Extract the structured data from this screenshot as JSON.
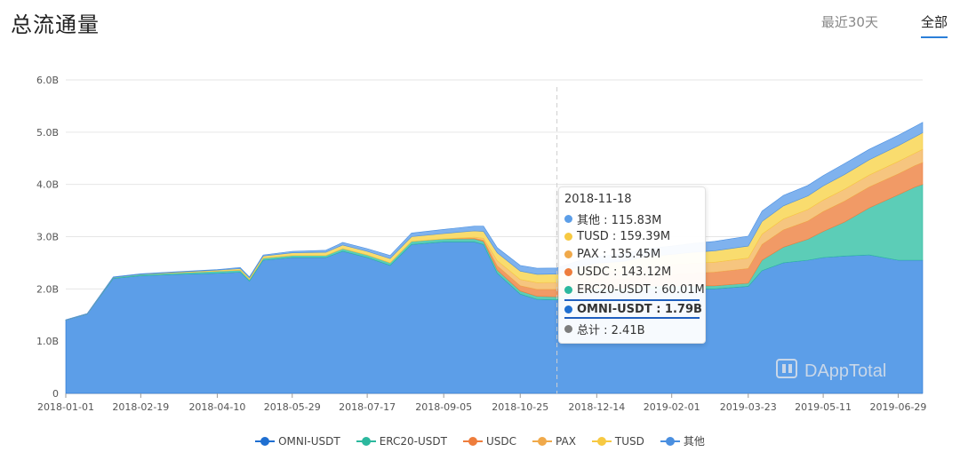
{
  "header": {
    "title": "总流通量",
    "tabs": [
      {
        "label": "最近30天",
        "active": false
      },
      {
        "label": "全部",
        "active": true
      }
    ]
  },
  "watermark": "DAppTotal",
  "tooltip": {
    "date": "2018-11-18",
    "rows": [
      {
        "text": "其他 : 115.83M",
        "color": "#5c9ee8",
        "highlight": false
      },
      {
        "text": "TUSD : 159.39M",
        "color": "#f7c942",
        "highlight": false
      },
      {
        "text": "PAX : 135.45M",
        "color": "#f0a94a",
        "highlight": false
      },
      {
        "text": "USDC : 143.12M",
        "color": "#ee7d3c",
        "highlight": false
      },
      {
        "text": "ERC20-USDT : 60.01M",
        "color": "#2cb89e",
        "highlight": false
      },
      {
        "text": "OMNI-USDT : 1.79B",
        "color": "#1f6fd1",
        "highlight": true
      },
      {
        "text": "总计 : 2.41B",
        "color": "#7d7d7d",
        "highlight": false
      }
    ]
  },
  "chart_data": {
    "type": "area",
    "stacked": true,
    "x": [
      "2018-01-01",
      "2018-01-15",
      "2018-02-01",
      "2018-02-19",
      "2018-03-15",
      "2018-04-10",
      "2018-04-25",
      "2018-05-01",
      "2018-05-10",
      "2018-05-29",
      "2018-06-20",
      "2018-07-01",
      "2018-07-17",
      "2018-08-01",
      "2018-08-15",
      "2018-09-05",
      "2018-09-25",
      "2018-10-01",
      "2018-10-10",
      "2018-10-25",
      "2018-11-05",
      "2018-11-18",
      "2018-12-01",
      "2018-12-14",
      "2019-01-01",
      "2019-01-15",
      "2019-02-01",
      "2019-02-15",
      "2019-03-01",
      "2019-03-23",
      "2019-04-01",
      "2019-04-15",
      "2019-05-01",
      "2019-05-11",
      "2019-05-25",
      "2019-06-10",
      "2019-06-29",
      "2019-07-10",
      "2019-07-15"
    ],
    "xticks": [
      "2018-01-01",
      "2018-02-19",
      "2018-04-10",
      "2018-05-29",
      "2018-07-17",
      "2018-09-05",
      "2018-10-25",
      "2018-12-14",
      "2019-02-01",
      "2019-03-23",
      "2019-05-11",
      "2019-06-29"
    ],
    "yticks": [
      "0",
      "1.0B",
      "2.0B",
      "3.0B",
      "4.0B",
      "5.0B",
      "6.0B"
    ],
    "ylim": [
      0,
      6.0
    ],
    "yunit": "B",
    "grid": true,
    "legend_position": "bottom",
    "crosshair_x": "2018-11-18",
    "series": [
      {
        "name": "OMNI-USDT",
        "color": "#1f6fd1",
        "fill": "#5c9ee8",
        "values": [
          1.4,
          1.52,
          2.2,
          2.25,
          2.28,
          2.3,
          2.32,
          2.15,
          2.55,
          2.6,
          2.6,
          2.72,
          2.6,
          2.45,
          2.85,
          2.9,
          2.9,
          2.85,
          2.3,
          1.9,
          1.8,
          1.79,
          1.9,
          1.95,
          1.95,
          2.0,
          2.0,
          2.0,
          2.0,
          2.05,
          2.35,
          2.5,
          2.55,
          2.6,
          2.63,
          2.65,
          2.55,
          2.55,
          2.55
        ]
      },
      {
        "name": "ERC20-USDT",
        "color": "#2cb89e",
        "fill": "#5ccdb7",
        "values": [
          0.005,
          0.005,
          0.02,
          0.03,
          0.03,
          0.04,
          0.04,
          0.03,
          0.04,
          0.04,
          0.04,
          0.05,
          0.05,
          0.05,
          0.06,
          0.06,
          0.06,
          0.06,
          0.06,
          0.06,
          0.06,
          0.06,
          0.06,
          0.06,
          0.06,
          0.06,
          0.06,
          0.06,
          0.06,
          0.06,
          0.2,
          0.3,
          0.4,
          0.5,
          0.65,
          0.9,
          1.25,
          1.4,
          1.45
        ]
      },
      {
        "name": "USDC",
        "color": "#ee7d3c",
        "fill": "#f19a66",
        "values": [
          0,
          0,
          0,
          0,
          0,
          0,
          0,
          0,
          0,
          0,
          0,
          0,
          0,
          0,
          0,
          0,
          0.01,
          0.02,
          0.08,
          0.1,
          0.13,
          0.14,
          0.15,
          0.16,
          0.18,
          0.2,
          0.22,
          0.24,
          0.26,
          0.28,
          0.3,
          0.33,
          0.35,
          0.38,
          0.4,
          0.4,
          0.4,
          0.41,
          0.42
        ]
      },
      {
        "name": "PAX",
        "color": "#f0a94a",
        "fill": "#f6c57f",
        "values": [
          0,
          0,
          0,
          0,
          0,
          0,
          0,
          0,
          0,
          0,
          0,
          0,
          0,
          0,
          0,
          0,
          0.02,
          0.04,
          0.1,
          0.12,
          0.13,
          0.135,
          0.14,
          0.15,
          0.16,
          0.17,
          0.18,
          0.19,
          0.19,
          0.2,
          0.2,
          0.21,
          0.22,
          0.22,
          0.23,
          0.23,
          0.24,
          0.24,
          0.25
        ]
      },
      {
        "name": "TUSD",
        "color": "#f7c942",
        "fill": "#f9dc6e",
        "values": [
          0,
          0,
          0,
          0,
          0.01,
          0.02,
          0.03,
          0.03,
          0.04,
          0.05,
          0.06,
          0.07,
          0.07,
          0.08,
          0.09,
          0.1,
          0.12,
          0.13,
          0.15,
          0.16,
          0.16,
          0.159,
          0.16,
          0.17,
          0.18,
          0.19,
          0.2,
          0.21,
          0.22,
          0.23,
          0.24,
          0.25,
          0.26,
          0.27,
          0.28,
          0.29,
          0.3,
          0.31,
          0.32
        ]
      },
      {
        "name": "其他",
        "color": "#4a8fe0",
        "fill": "#7fb2ee",
        "values": [
          0.005,
          0.005,
          0.01,
          0.01,
          0.01,
          0.01,
          0.02,
          0.02,
          0.02,
          0.03,
          0.04,
          0.05,
          0.05,
          0.06,
          0.07,
          0.08,
          0.09,
          0.1,
          0.1,
          0.11,
          0.115,
          0.116,
          0.12,
          0.13,
          0.14,
          0.15,
          0.16,
          0.17,
          0.18,
          0.19,
          0.2,
          0.2,
          0.2,
          0.2,
          0.21,
          0.2,
          0.2,
          0.2,
          0.2
        ]
      }
    ]
  }
}
